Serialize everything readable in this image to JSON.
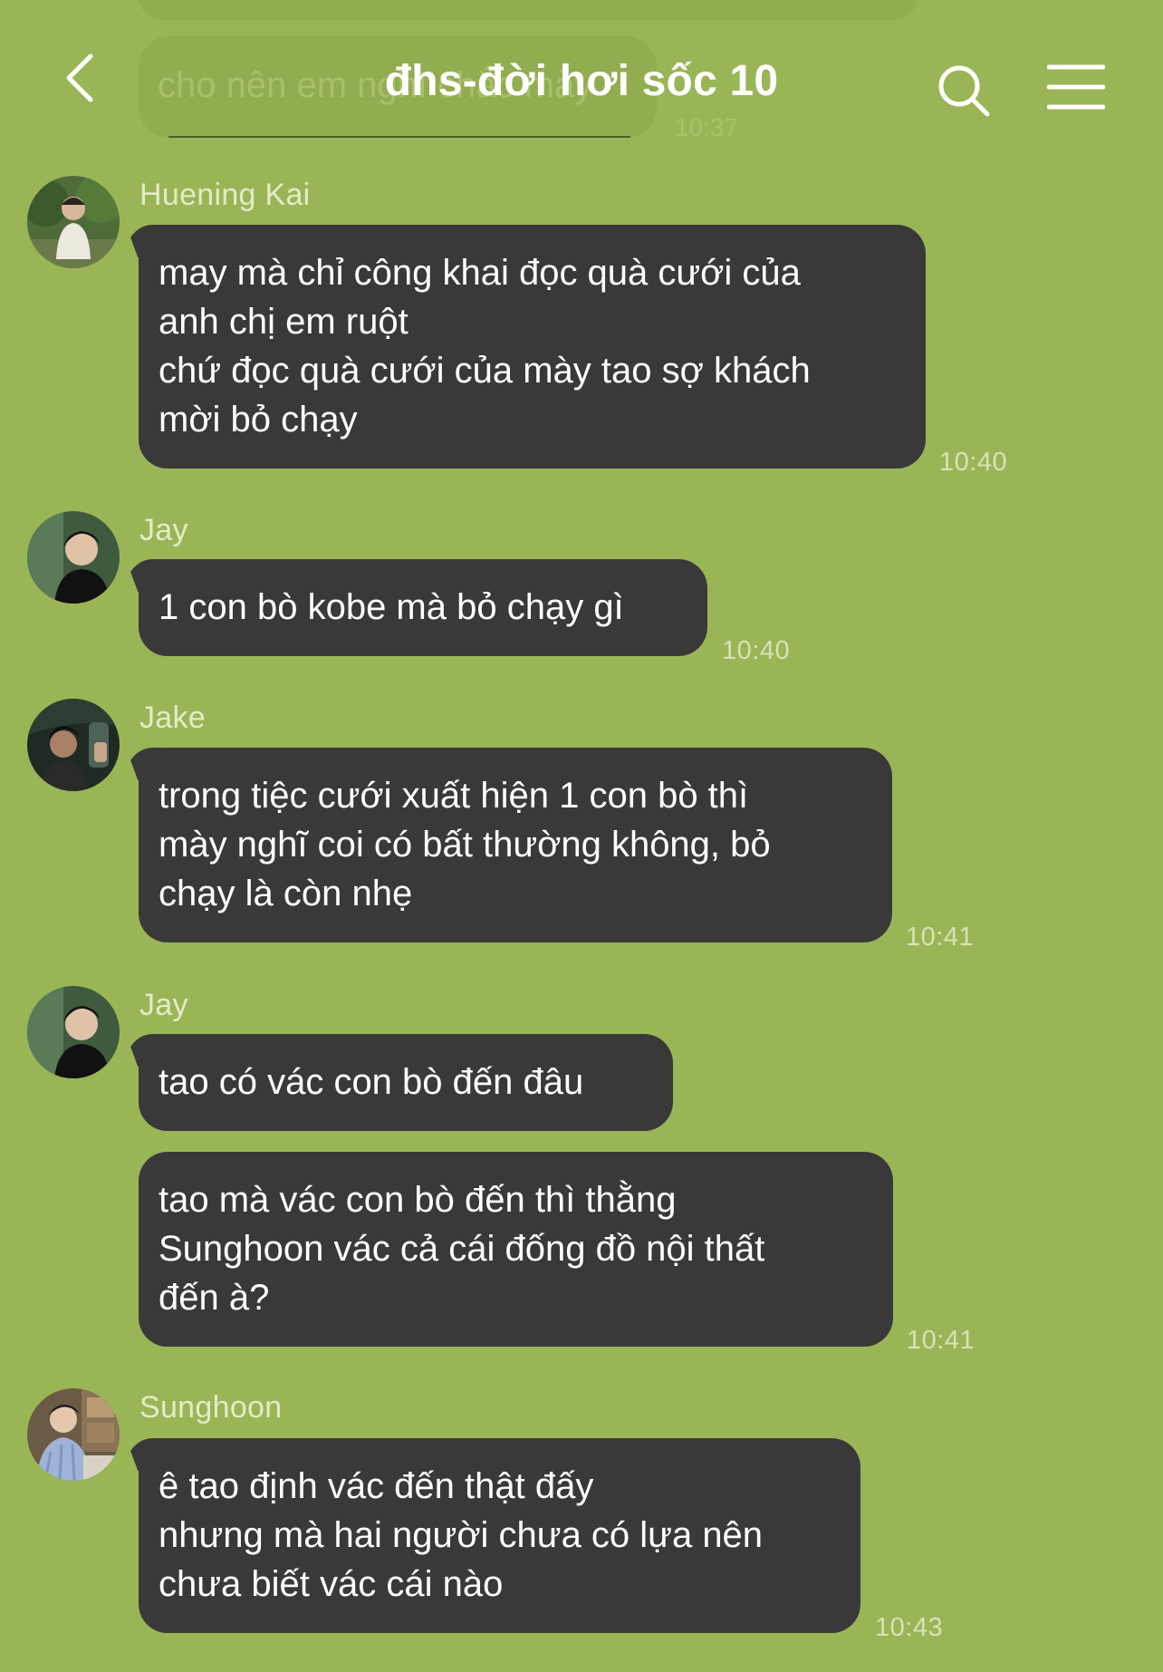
{
  "header": {
    "title": "đhs-đời hơi sốc 10",
    "background_preview_text": "cho nên em nghĩ chắc mày",
    "background_preview_time": "10:37"
  },
  "colors": {
    "background": "#9AB556",
    "bubble": "#393939",
    "text": "#FFFFFF",
    "time": "#D7E3B6"
  },
  "messages": [
    {
      "sender": "Huening Kai",
      "text": "may mà chỉ công khai đọc quà cưới của\nanh chị em ruột\nchứ đọc quà cưới của mày tao sợ khách\nmời bỏ chạy",
      "time": "10:40"
    },
    {
      "sender": "Jay",
      "text": "1 con bò kobe mà bỏ chạy gì",
      "time": "10:40"
    },
    {
      "sender": "Jake",
      "text": "trong tiệc cưới xuất hiện 1 con bò thì\nmày nghĩ coi có bất thường không, bỏ\nchạy là còn nhẹ",
      "time": "10:41"
    },
    {
      "sender": "Jay",
      "text": "tao có vác con bò đến đâu",
      "time": ""
    },
    {
      "sender": "",
      "text": "tao mà vác con bò đến thì thằng\nSunghoon vác cả cái đống đồ nội thất\nđến à?",
      "time": "10:41"
    },
    {
      "sender": "Sunghoon",
      "text": "ê tao định vác đến thật đấy\nnhưng mà hai người chưa có lựa nên\nchưa biết vác cái nào",
      "time": "10:43"
    }
  ]
}
